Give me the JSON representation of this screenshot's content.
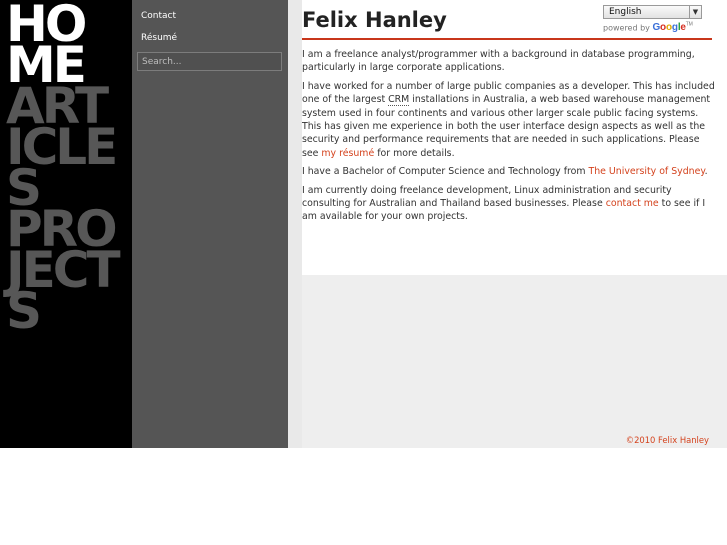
{
  "big_nav": [
    {
      "label": "HO\nME",
      "active": true
    },
    {
      "label": "ART\nICLE\nS",
      "active": false
    },
    {
      "label": "PRO\nJECT\nS",
      "active": false
    }
  ],
  "sidebar": {
    "contact_label": "Contact",
    "resume_label": "Résumé",
    "search_placeholder": "Search..."
  },
  "translate": {
    "selected_language": "English",
    "powered_by": "powered by",
    "google_letters": [
      "G",
      "o",
      "o",
      "g",
      "l",
      "e"
    ],
    "trademark": "TM"
  },
  "main": {
    "title": "Felix Hanley",
    "p1": "I am a freelance analyst/programmer with a background in database programming, particularly in large corporate applications.",
    "p2_a": "I have worked for a number of large public companies as a developer. This has included one of the largest ",
    "p2_abbr": "CRM",
    "p2_b": " installations in Australia, a web based warehouse management system used in four continents and various other larger scale public facing systems. This has given me experience in both the user interface design aspects as well as the security and performance requirements that are needed in such applications. Please see ",
    "p2_link": "my résumé",
    "p2_c": " for more details.",
    "p3_a": "I have a Bachelor of Computer Science and Technology from ",
    "p3_link": "The University of Sydney",
    "p3_b": ".",
    "p4_a": "I am currently doing freelance development, Linux administration and security consulting for Australian and Thailand based businesses. Please ",
    "p4_link": "contact me",
    "p4_b": " to see if I am available for your own projects."
  },
  "footer": "©2010 Felix Hanley",
  "colors": {
    "accent": "#d4431e",
    "rule": "#c8361b",
    "nav_active": "#ffffff",
    "nav_inactive": "#575757"
  }
}
